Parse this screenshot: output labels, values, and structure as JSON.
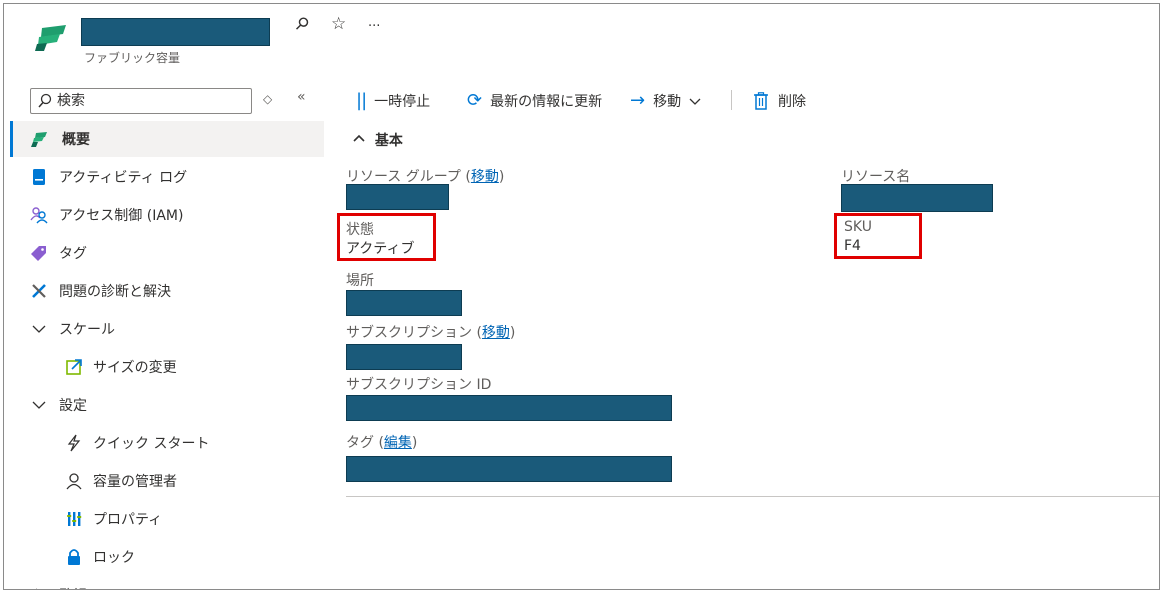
{
  "header": {
    "subtitle": "ファブリック容量",
    "pin_glyph": "⚲",
    "star_glyph": "☆",
    "more_glyph": "···"
  },
  "search": {
    "placeholder": "検索"
  },
  "sidebar_controls": {
    "sort_glyph": "◇",
    "collapse_glyph": "«"
  },
  "sidebar": {
    "items": [
      {
        "label": "概要",
        "icon": "fabric-logo-icon",
        "active": true
      },
      {
        "label": "アクティビティ ログ",
        "icon": "activity-log-icon"
      },
      {
        "label": "アクセス制御 (IAM)",
        "icon": "people-icon"
      },
      {
        "label": "タグ",
        "icon": "tag-icon"
      },
      {
        "label": "問題の診断と解決",
        "icon": "wrench-icon"
      },
      {
        "label": "スケール",
        "icon": "chevron-down-icon",
        "group": true
      },
      {
        "label": "サイズの変更",
        "icon": "resize-icon"
      },
      {
        "label": "設定",
        "icon": "chevron-down-icon",
        "group": true
      },
      {
        "label": "クイック スタート",
        "icon": "lightning-icon"
      },
      {
        "label": "容量の管理者",
        "icon": "person-icon"
      },
      {
        "label": "プロパティ",
        "icon": "properties-icon"
      },
      {
        "label": "ロック",
        "icon": "lock-icon"
      },
      {
        "label": "監視",
        "icon": "chevron-right-icon",
        "group": true
      }
    ]
  },
  "toolbar": {
    "pause": "一時停止",
    "refresh": "最新の情報に更新",
    "move": "移動",
    "delete": "削除"
  },
  "essentials": {
    "title": "基本",
    "resource_group_label": "リソース グループ",
    "resource_name_label": "リソース名",
    "status_label": "状態",
    "status_value": "アクティブ",
    "sku_label": "SKU",
    "sku_value": "F4",
    "location_label": "場所",
    "subscription_label": "サブスクリプション",
    "subscription_id_label": "サブスクリプション ID",
    "tags_label": "タグ",
    "move_link": "移動",
    "edit_link": "編集",
    "paren_open": " (",
    "paren_close": ")"
  },
  "colors": {
    "accent": "#0078d4",
    "redaction": "#1a5a7a",
    "highlight": "#e00000",
    "link": "#0064b4"
  }
}
